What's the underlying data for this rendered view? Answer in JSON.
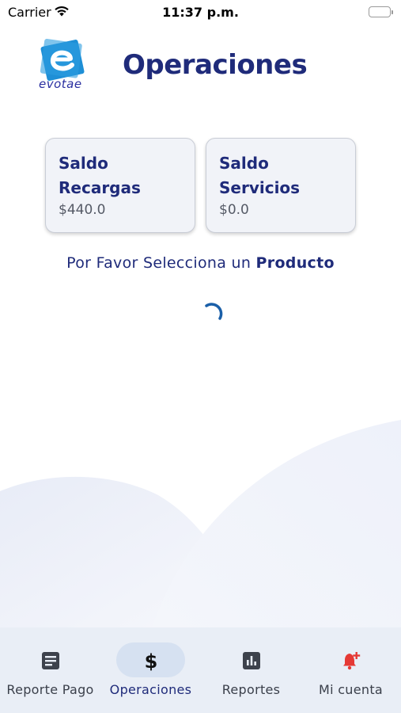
{
  "status_bar": {
    "carrier": "Carrier",
    "time": "11:37 p.m."
  },
  "header": {
    "logo_text": "evotae",
    "title": "Operaciones"
  },
  "cards": [
    {
      "title": "Saldo Recargas",
      "value": "$440.0"
    },
    {
      "title": "Saldo Servicios",
      "value": "$0.0"
    }
  ],
  "prompt": {
    "text": "Por Favor Selecciona un",
    "bold": "Producto"
  },
  "nav": {
    "items": [
      {
        "label": "Reporte Pago",
        "icon": "document-icon",
        "active": false
      },
      {
        "label": "Operaciones",
        "icon": "dollar-icon",
        "active": true
      },
      {
        "label": "Reportes",
        "icon": "bar-chart-icon",
        "active": false
      },
      {
        "label": "Mi cuenta",
        "icon": "bell-add-icon",
        "active": false
      }
    ]
  },
  "colors": {
    "primary": "#1f2b7a",
    "logo_blue": "#1e8fd6",
    "nav_background": "#e9eef6",
    "nav_active_pill": "#d6e1f1",
    "bell_red": "#e53935"
  }
}
